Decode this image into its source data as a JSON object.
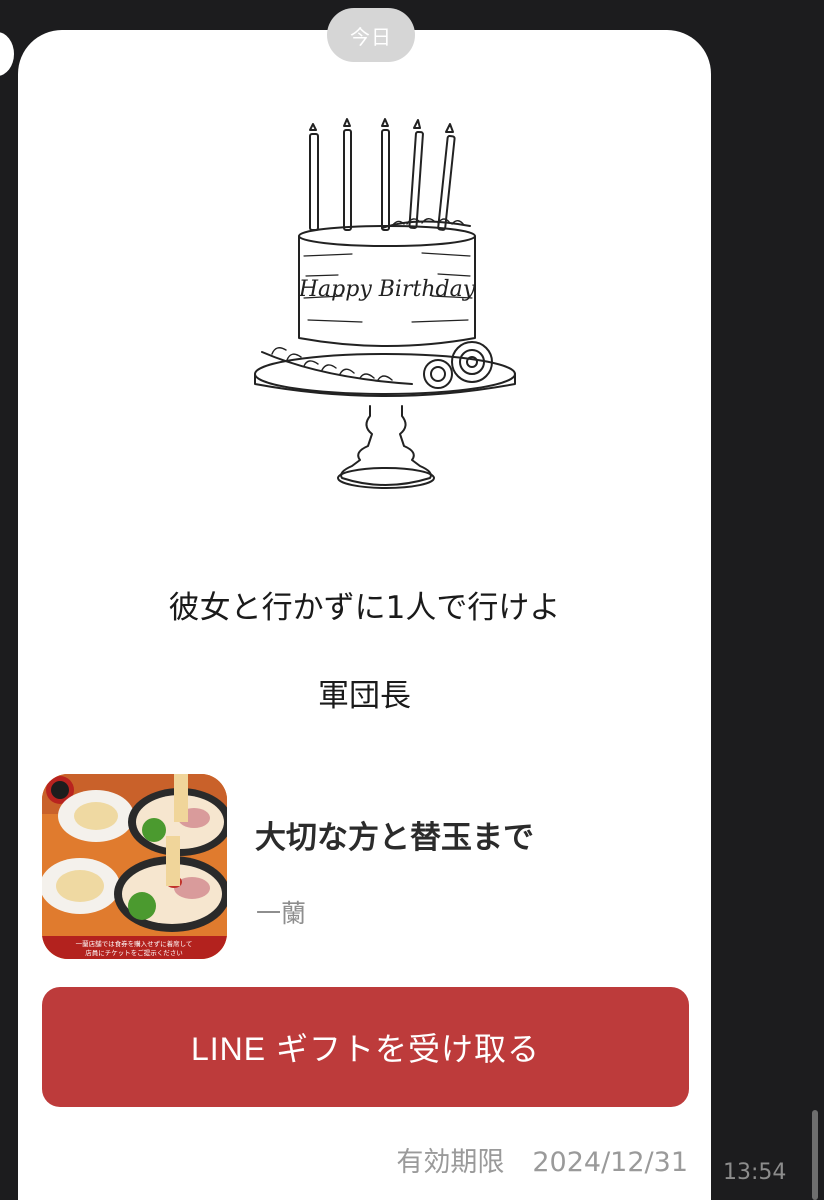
{
  "chat": {
    "date_label": "今日",
    "timestamp": "13:54"
  },
  "card": {
    "cake_text": "Happy Birthday",
    "message_line1": "彼女と行かずに1人で行けよ",
    "message_line2": "軍団長",
    "gift": {
      "title": "大切な方と替玉まで",
      "brand": "一蘭",
      "thumbnail_caption_line1": "一蘭店舗では食券を購入せずに着席して",
      "thumbnail_caption_line2": "店員にチケットをご提示ください"
    },
    "receive_button_label": "LINE ギフトを受け取る",
    "expiry_label": "有効期限",
    "expiry_date": "2024/12/31"
  },
  "colors": {
    "background": "#1c1c1e",
    "card": "#ffffff",
    "button": "#bd3b3b"
  }
}
